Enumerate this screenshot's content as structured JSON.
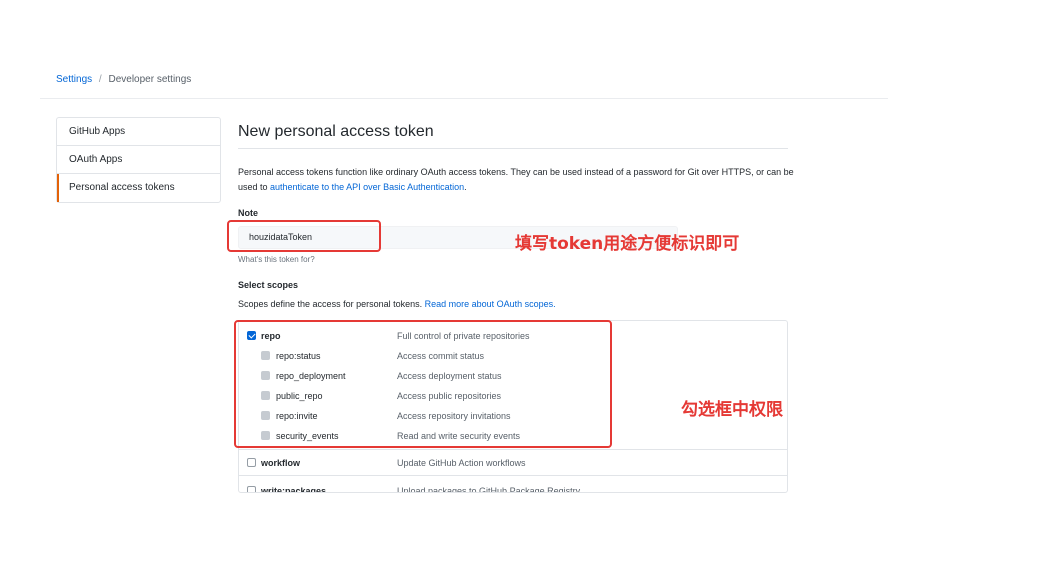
{
  "breadcrumb": {
    "settings": "Settings",
    "separator": "/",
    "current": "Developer settings"
  },
  "sidebar": {
    "items": [
      {
        "label": "GitHub Apps",
        "active": false
      },
      {
        "label": "OAuth Apps",
        "active": false
      },
      {
        "label": "Personal access tokens",
        "active": true
      }
    ]
  },
  "page": {
    "title": "New personal access token",
    "intro_text": "Personal access tokens function like ordinary OAuth access tokens. They can be used instead of a password for Git over HTTPS, or can be used to ",
    "intro_link": "authenticate to the API over Basic Authentication",
    "intro_end": "."
  },
  "note": {
    "label": "Note",
    "value": "houzidataToken",
    "help": "What's this token for?"
  },
  "scopes": {
    "label": "Select scopes",
    "desc": "Scopes define the access for personal tokens. ",
    "desc_link": "Read more about OAuth scopes.",
    "items": [
      {
        "name": "repo",
        "desc": "Full control of private repositories",
        "state": "checked"
      },
      {
        "name": "repo:status",
        "desc": "Access commit status",
        "state": "disabled"
      },
      {
        "name": "repo_deployment",
        "desc": "Access deployment status",
        "state": "disabled"
      },
      {
        "name": "public_repo",
        "desc": "Access public repositories",
        "state": "disabled"
      },
      {
        "name": "repo:invite",
        "desc": "Access repository invitations",
        "state": "disabled"
      },
      {
        "name": "security_events",
        "desc": "Read and write security events",
        "state": "disabled"
      },
      {
        "name": "workflow",
        "desc": "Update GitHub Action workflows",
        "state": "unchecked"
      },
      {
        "name": "write:packages",
        "desc": "Upload packages to GitHub Package Registry",
        "state": "unchecked"
      }
    ]
  },
  "annotations": {
    "note_hint": "填写token用途方便标识即可",
    "scope_hint": "勾选框中权限"
  },
  "colors": {
    "accent": "#0366d6",
    "annotation": "#e53935",
    "sidebar_active": "#e36209"
  }
}
